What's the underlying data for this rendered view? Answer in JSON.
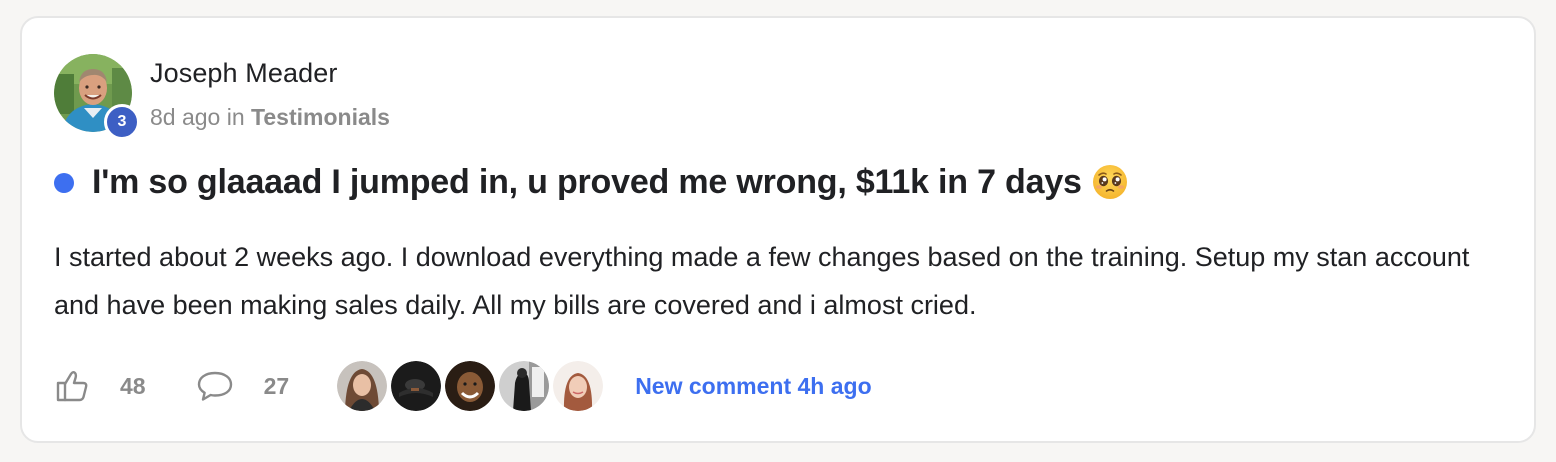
{
  "post": {
    "author": {
      "name": "Joseph Meader",
      "level": "3"
    },
    "time_ago": "8d ago",
    "in_label": "in",
    "category": "Testimonials",
    "title": "I'm so glaaaad I jumped in, u proved me wrong, $11k in 7 days",
    "title_emoji": "pleading-face-emoji",
    "body": "I started about 2 weeks ago. I download everything made a few changes based on the training. Setup my stan account and have been making sales daily. All my bills are covered and i almost cried.",
    "likes": "48",
    "comments": "27",
    "new_comment_label": "New comment 4h ago"
  },
  "icons": {
    "like": "thumbs-up-icon",
    "comment": "speech-bubble-icon"
  },
  "colors": {
    "accent": "#3d6ff0",
    "level_badge": "#3d5fc4",
    "muted_text": "#8a8a8a",
    "card_border": "#e6e6e6",
    "page_background": "#f7f6f4"
  }
}
